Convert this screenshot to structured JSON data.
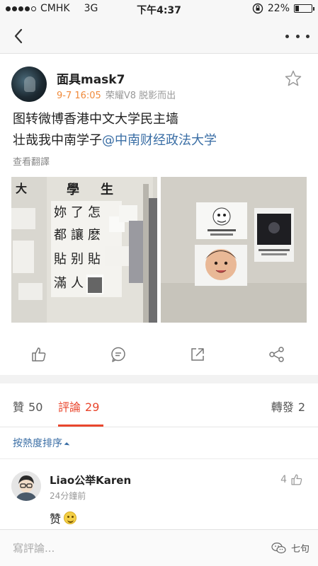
{
  "status_bar": {
    "carrier": "CMHK",
    "network": "3G",
    "time": "下午4:37",
    "battery_text": "22%",
    "battery_level": 0.22
  },
  "post": {
    "username": "面具mask7",
    "time": "9-7 16:05",
    "device": "荣耀V8 脱影而出",
    "text_line1": "图转微博香港中文大学民主墙",
    "text_line2_prefix": "壮哉我中南学子",
    "mention": "@中南财经政法大学",
    "translate": "查看翻譯"
  },
  "photo_left": {
    "banner": [
      "大",
      "學",
      "生"
    ],
    "chars": [
      "妳",
      "了",
      "怎",
      "都",
      "讓",
      "麽",
      "貼",
      "别",
      "貼",
      "滿",
      "人"
    ]
  },
  "photo_right": {},
  "tabs": {
    "likes": {
      "label": "贊",
      "count": "50"
    },
    "comments": {
      "label": "評論",
      "count": "29"
    },
    "reposts": {
      "label": "轉發",
      "count": "2"
    }
  },
  "sort": {
    "label": "按熱度排序"
  },
  "comment": {
    "name": "Liao公举Karen",
    "time": "24分鐘前",
    "text": "赞",
    "likes": "4"
  },
  "bottom": {
    "placeholder": "寫評論...",
    "watermark": "七句"
  },
  "colors": {
    "accent": "#e9462d",
    "link": "#3a6ea5",
    "meta_orange": "#f08a3a"
  },
  "icons": [
    "chevron-left-icon",
    "more-icon",
    "star-icon",
    "thumbs-up-icon",
    "comment-icon",
    "repost-icon",
    "share-icon",
    "wechat-icon"
  ]
}
